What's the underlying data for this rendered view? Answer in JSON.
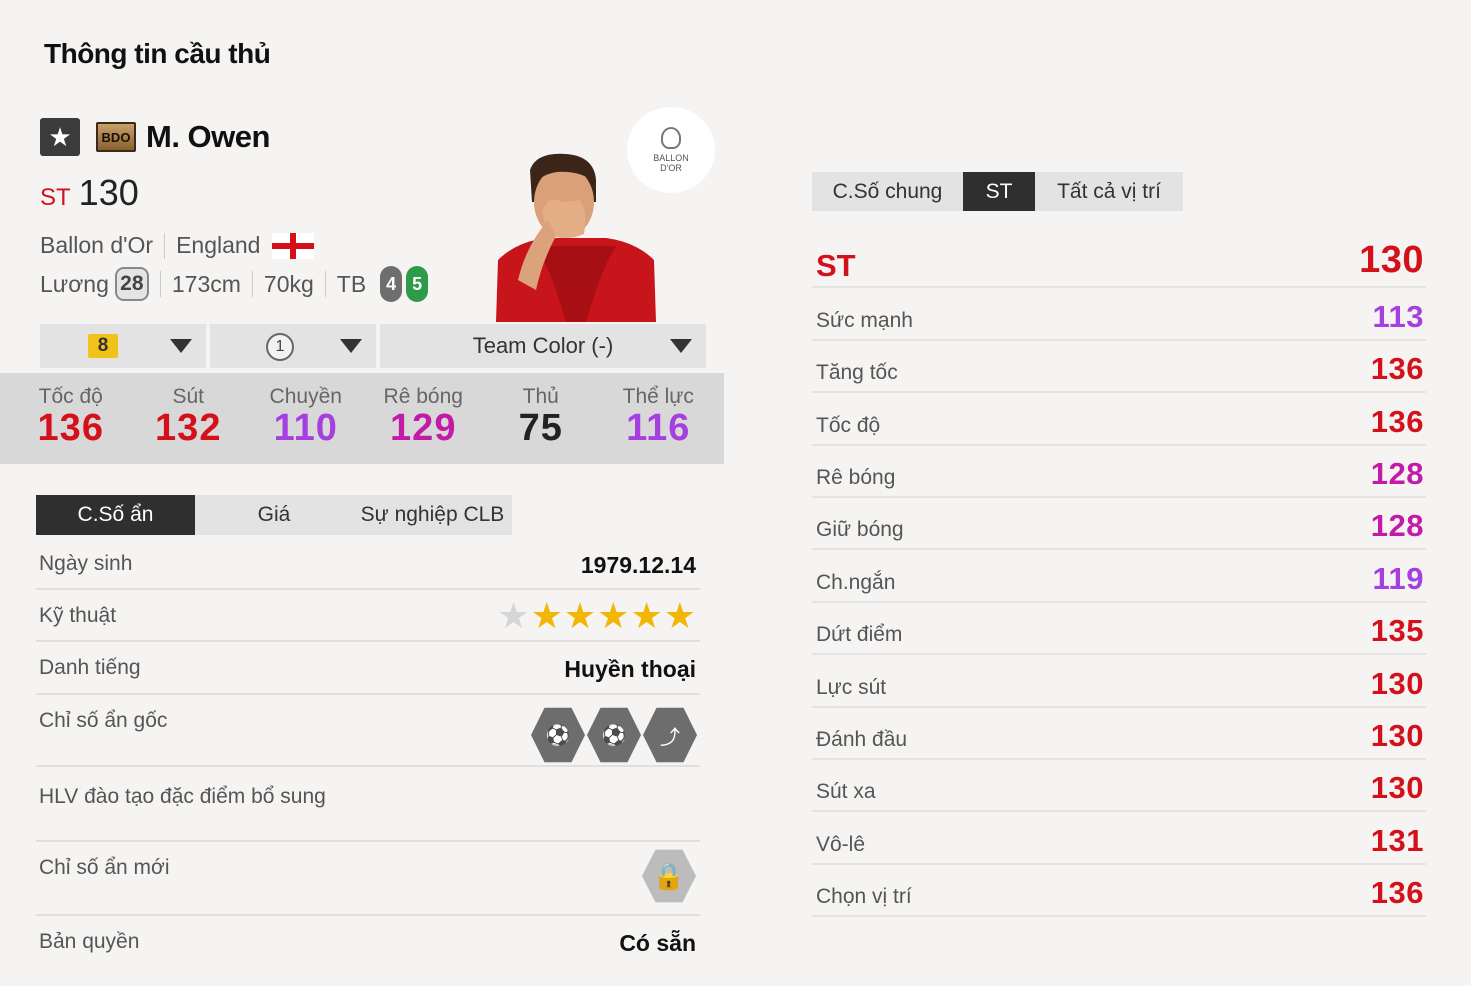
{
  "page_title": "Thông tin cầu thủ",
  "player": {
    "name": "M. Owen",
    "season_badge": "BDO",
    "position": "ST",
    "overall": "130",
    "club": "Ballon d'Or",
    "nation": "England",
    "salary_label": "Lương",
    "salary": "28",
    "height": "173cm",
    "weight": "70kg",
    "body_type": "TB",
    "weak_foot": "4",
    "strong_foot": "5",
    "logo_text_1": "BALLON",
    "logo_text_2": "D'OR"
  },
  "selectors": {
    "upgrade_level": "8",
    "team_level": "1",
    "team_color": "Team Color (-)"
  },
  "main_stats": [
    {
      "label": "Tốc độ",
      "value": "136",
      "color": "#d4111b"
    },
    {
      "label": "Sút",
      "value": "132",
      "color": "#d4111b"
    },
    {
      "label": "Chuyền",
      "value": "110",
      "color": "#a63fe0"
    },
    {
      "label": "Rê bóng",
      "value": "129",
      "color": "#c41aa8"
    },
    {
      "label": "Thủ",
      "value": "75",
      "color": "#222222"
    },
    {
      "label": "Thể lực",
      "value": "116",
      "color": "#a63fe0"
    }
  ],
  "left_tabs": [
    "C.Số ẩn",
    "Giá",
    "Sự nghiệp CLB"
  ],
  "info": {
    "birth_label": "Ngày sinh",
    "birth_value": "1979.12.14",
    "skill_label": "Kỹ thuật",
    "skill_stars": 5,
    "rep_label": "Danh tiếng",
    "rep_value": "Huyền thoại",
    "traits_label": "Chỉ số ẩn gốc",
    "coach_label": "HLV đào tạo đặc điểm bổ sung",
    "new_traits_label": "Chỉ số ẩn mới",
    "license_label": "Bản quyền",
    "license_value": "Có sẵn"
  },
  "right_tabs": [
    "C.Số chung",
    "ST",
    "Tất cả vị trí"
  ],
  "position_rating": {
    "label": "ST",
    "value": "130"
  },
  "attributes": [
    {
      "name": "Sức mạnh",
      "value": "113",
      "color": "#a63fe0"
    },
    {
      "name": "Tăng tốc",
      "value": "136",
      "color": "#d4111b"
    },
    {
      "name": "Tốc độ",
      "value": "136",
      "color": "#d4111b"
    },
    {
      "name": "Rê bóng",
      "value": "128",
      "color": "#c41aa8"
    },
    {
      "name": "Giữ bóng",
      "value": "128",
      "color": "#c41aa8"
    },
    {
      "name": "Ch.ngắn",
      "value": "119",
      "color": "#a63fe0"
    },
    {
      "name": "Dứt điểm",
      "value": "135",
      "color": "#d4111b"
    },
    {
      "name": "Lực sút",
      "value": "130",
      "color": "#d4111b"
    },
    {
      "name": "Đánh đầu",
      "value": "130",
      "color": "#d4111b"
    },
    {
      "name": "Sút xa",
      "value": "130",
      "color": "#d4111b"
    },
    {
      "name": "Vô-lê",
      "value": "131",
      "color": "#d4111b"
    },
    {
      "name": "Chọn vị trí",
      "value": "136",
      "color": "#d4111b"
    }
  ],
  "colors": {
    "accent_red": "#d4111b",
    "purple": "#a63fe0",
    "magenta": "#c41aa8",
    "star_gold": "#f2b705",
    "tab_active": "#2f2f2f"
  }
}
